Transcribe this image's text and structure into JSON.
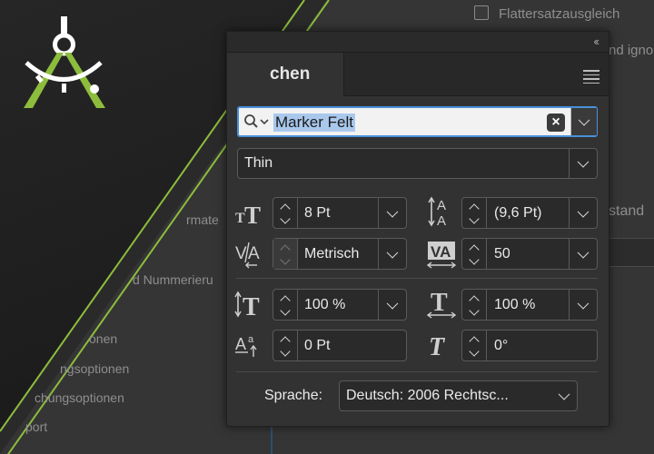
{
  "background": {
    "checkbox_label": "Flattersatzausgleich",
    "right_text_1": "nd igno",
    "right_text_2": "stand",
    "left_items": [
      "rmate",
      "d Nummerieru",
      "onen",
      "ngsoptionen",
      "chungsoptionen",
      "port"
    ]
  },
  "panel": {
    "collapse_label": "‹‹",
    "tab_label": "chen",
    "font_family": "Marker Felt",
    "font_style": "Thin",
    "size": "8 Pt",
    "leading": "(9,6 Pt)",
    "kerning": "Metrisch",
    "tracking": "50",
    "vertical_scale": "100 %",
    "horizontal_scale": "100 %",
    "baseline_shift": "0 Pt",
    "skew": "0°",
    "language_label": "Sprache:",
    "language_value": "Deutsch: 2006 Rechtsc..."
  },
  "colors": {
    "accent_green": "#8dbd3c",
    "selection": "#a9c8ec",
    "focus": "#4a90d9"
  }
}
